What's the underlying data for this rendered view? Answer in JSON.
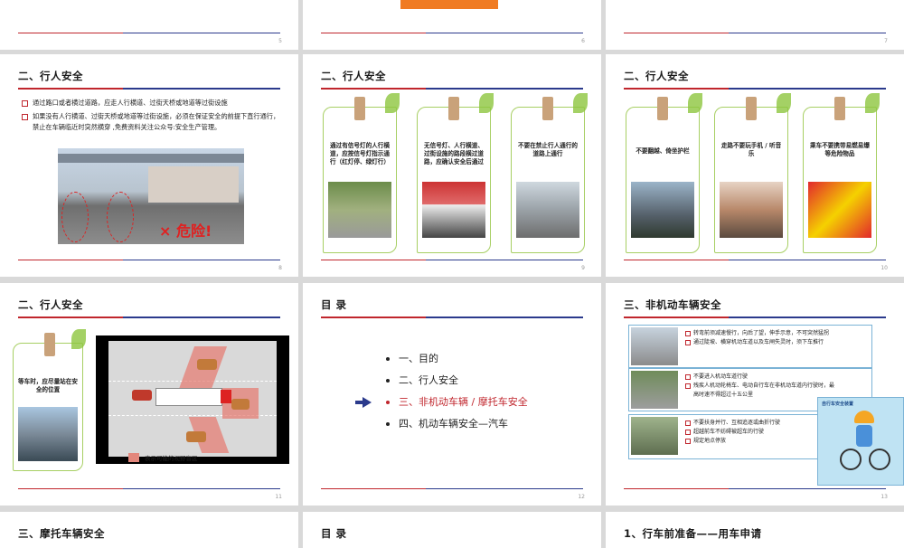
{
  "slides": {
    "s5": {
      "page": "5"
    },
    "s6": {
      "page": "6"
    },
    "s7": {
      "page": "7"
    },
    "s8": {
      "title": "二、行人安全",
      "page": "8",
      "bullets": [
        "通过路口或者横过道路，应走人行横道、过街天桥或地道等过街设施",
        "如果没有人行横道、过街天桥或地道等过街设施，必须在保证安全的前提下直行通行，禁止在车辆临近时突然横穿 ,免费资料关注公众号:安全生产管理。"
      ],
      "danger_label": "× 危险!"
    },
    "s9": {
      "title": "二、行人安全",
      "page": "9",
      "cards": [
        "通过有信号灯的人行横道，应按信号灯指示通行（红灯停、绿灯行）",
        "无信号灯、人行横道、过街设施的路段横过道路，应确认安全后通过",
        "不要在禁止行人通行的道路上通行"
      ]
    },
    "s10": {
      "title": "二、行人安全",
      "page": "10",
      "cards": [
        "不要翻越、倚坐护栏",
        "走路不要玩手机 / 听音乐",
        "乘车不要携带易燃易爆等危险物品"
      ]
    },
    "s11": {
      "title": "二、行人安全",
      "page": "11",
      "card": "等车时，应尽量站在安全的位置",
      "legend": "表示可能的视野盲区"
    },
    "s12": {
      "title": "目 录",
      "page": "12",
      "toc": [
        "一、目的",
        "二、行人安全",
        "三、非机动车辆 / 摩托车安全",
        "四、机动车辆安全—汽车"
      ],
      "active_index": 2
    },
    "s13": {
      "title": "三、非机动车辆安全",
      "page": "13",
      "rows": [
        [
          "转弯前须减速慢行，向后了望，伸手示意，不可突然猛拐",
          "通过陡坡、横穿机动车道以及车闸失灵时，须下车推行"
        ],
        [
          "不要进入机动车道行驶",
          "残疾人机动轮椅车、电动自行车在非机动车道内行驶时，最高时速不得超过十五公里"
        ],
        [
          "不要扶身并行、互相追逐或曲折行驶",
          "超越前车不妨碍被超车的行驶",
          "规定地点停放"
        ]
      ],
      "poster_title": "自行车安全装置"
    },
    "s14": {
      "title": "三、摩托车辆安全"
    },
    "s15": {
      "title": "目 录"
    },
    "s16": {
      "title": "1、行车前准备——用车申请"
    }
  }
}
